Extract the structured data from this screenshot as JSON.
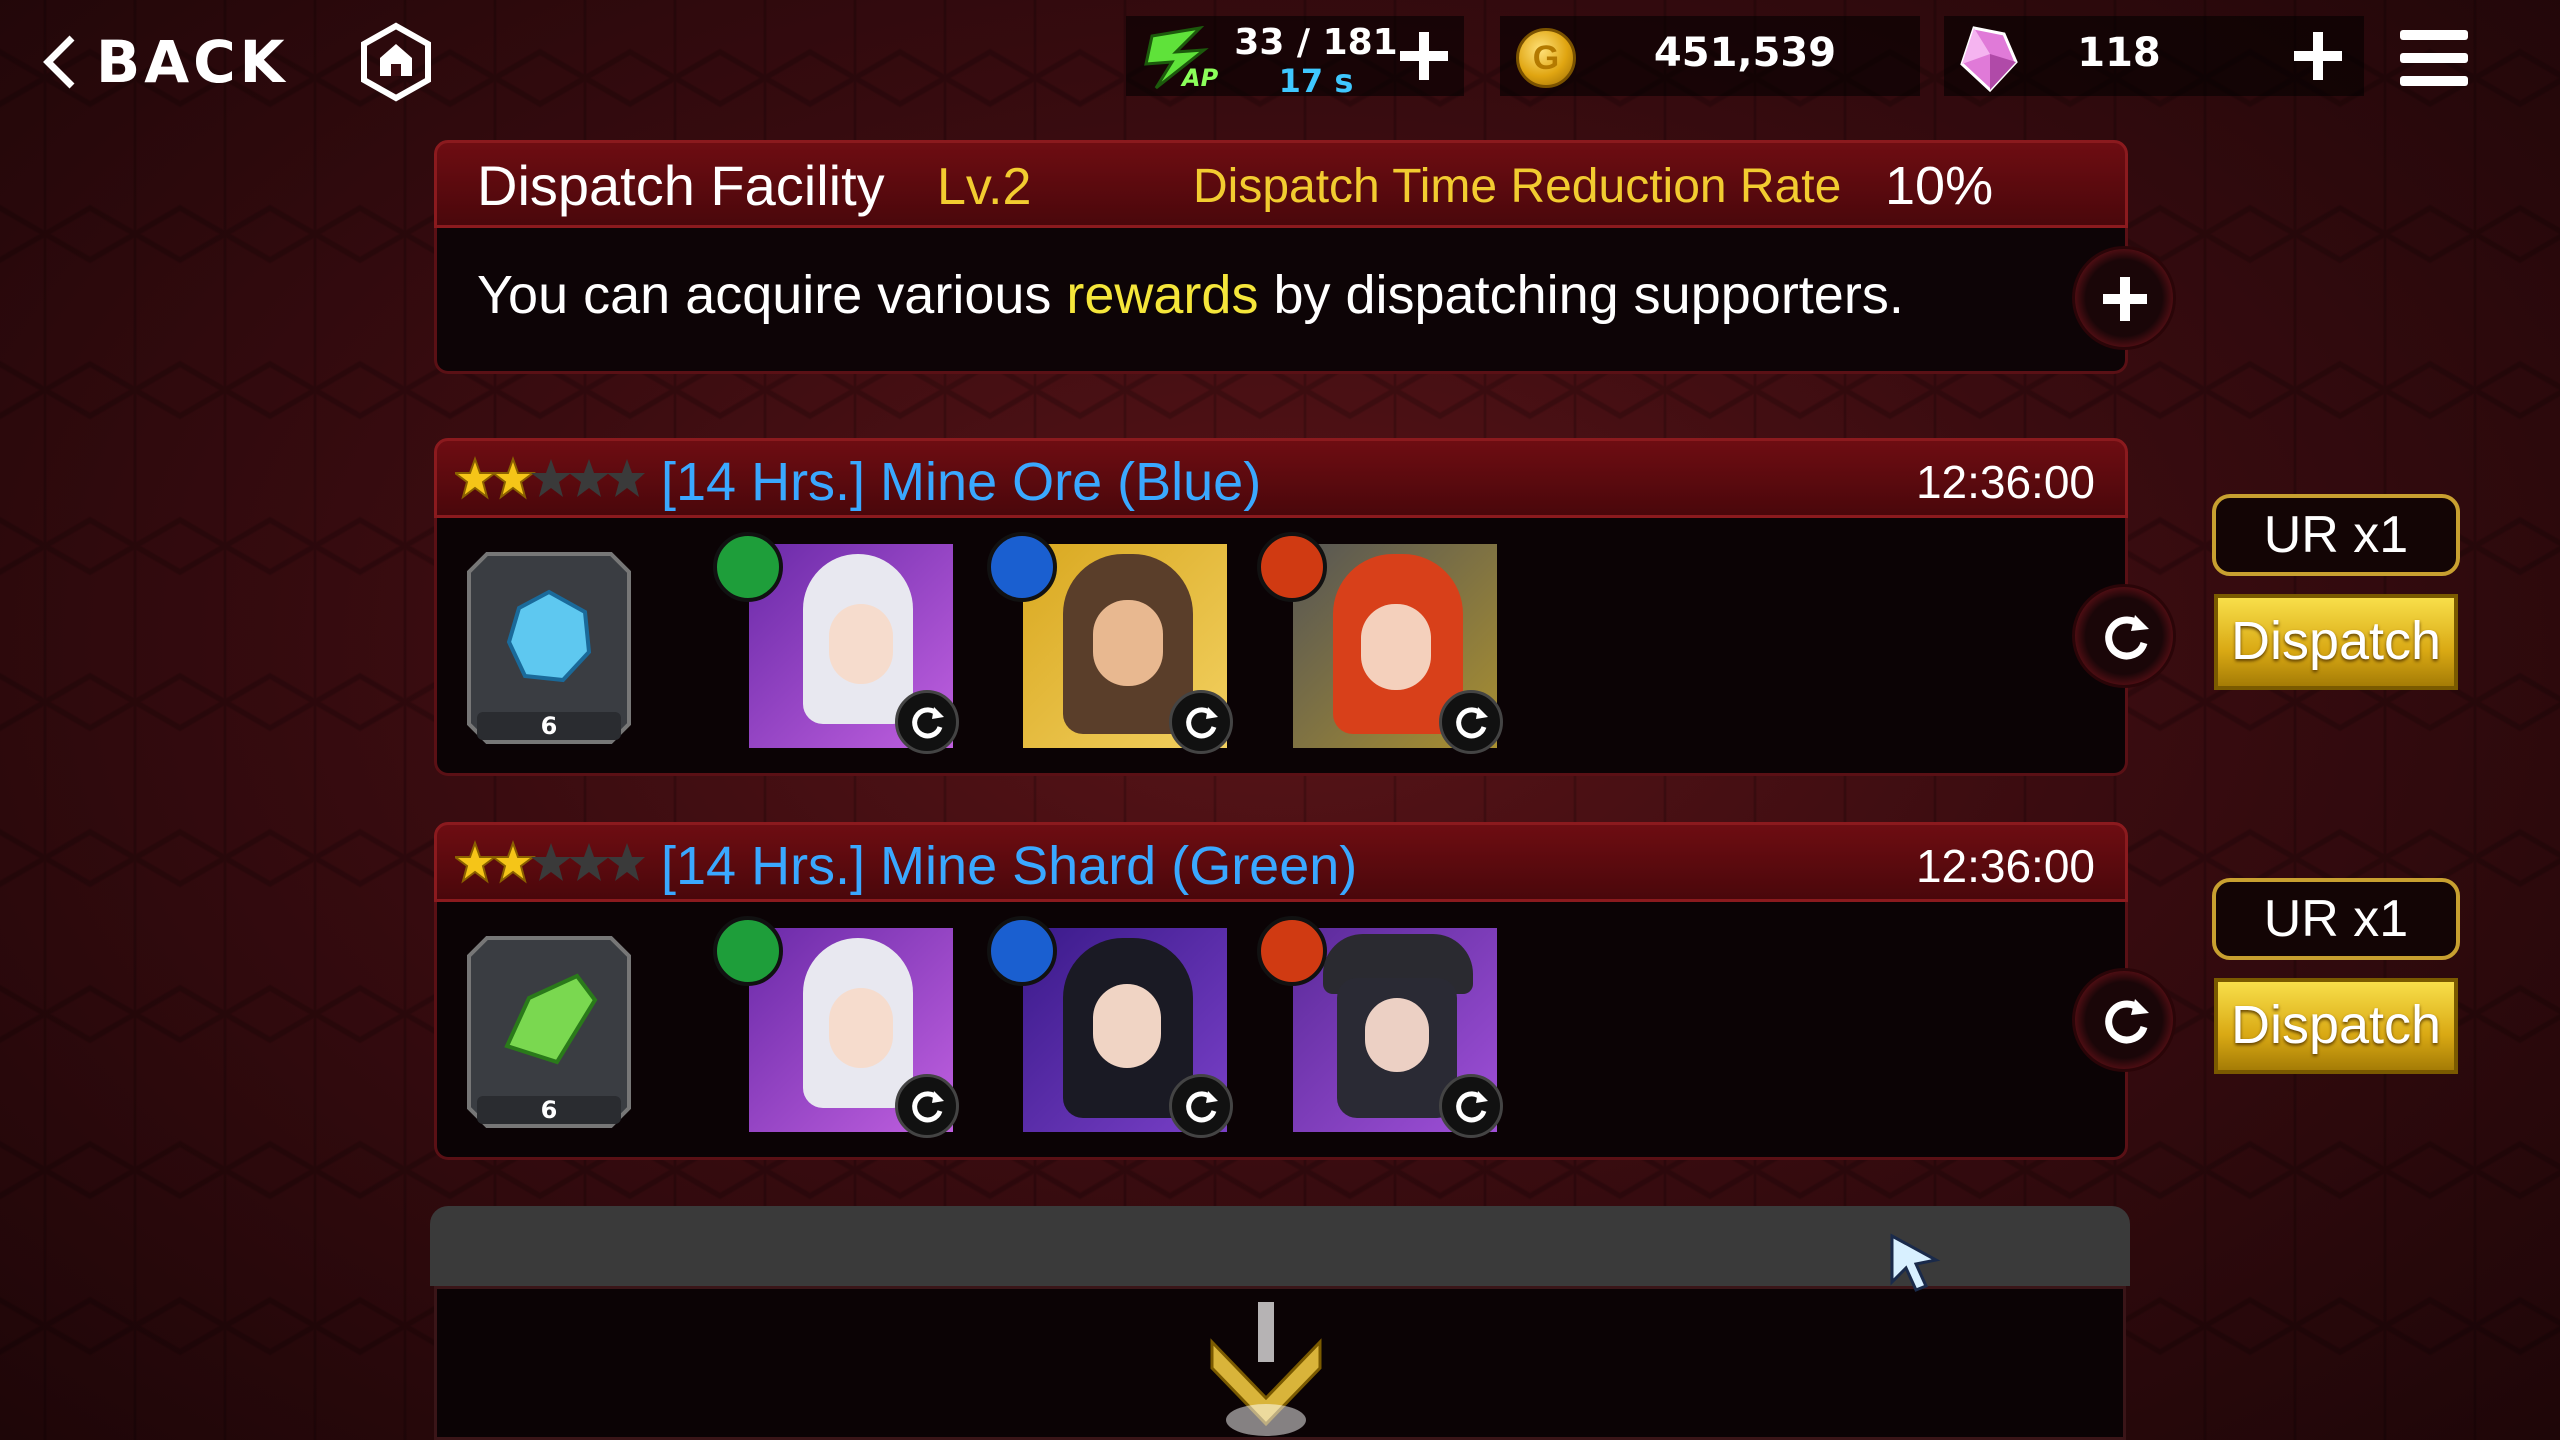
{
  "topbar": {
    "back_label": "BACK",
    "ap_current_max": "33 / 181",
    "ap_timer": "17 s",
    "ap_icon_label": "AP",
    "gold": "451,539",
    "gems": "118"
  },
  "facility": {
    "title": "Dispatch Facility",
    "level": "Lv.2",
    "rate_label": "Dispatch Time Reduction Rate",
    "rate_value": "10%",
    "desc_pre": "You can acquire various ",
    "desc_highlight": "rewards",
    "desc_post": " by dispatching supporters."
  },
  "missions": [
    {
      "stars_filled": 2,
      "stars_total": 5,
      "title": "[14 Hrs.] Mine Ore (Blue)",
      "time": "12:36:00",
      "item": {
        "icon": "blue-ore-icon",
        "count": "6",
        "color": "#4fb8e8"
      },
      "supporters": [
        {
          "element": "wind-icon",
          "element_color": "#1e9e3a",
          "portrait": "white-haired-girl"
        },
        {
          "element": "water-icon",
          "element_color": "#1a5fd0",
          "portrait": "brown-haired-girl"
        },
        {
          "element": "fire-icon",
          "element_color": "#d03a12",
          "portrait": "red-haired-girl"
        }
      ],
      "requirement": "UR x1",
      "dispatch_label": "Dispatch"
    },
    {
      "stars_filled": 2,
      "stars_total": 5,
      "title": "[14 Hrs.] Mine Shard (Green)",
      "time": "12:36:00",
      "item": {
        "icon": "green-shard-icon",
        "count": "6",
        "color": "#6fd048"
      },
      "supporters": [
        {
          "element": "wind-icon",
          "element_color": "#1e9e3a",
          "portrait": "white-haired-girl"
        },
        {
          "element": "water-icon",
          "element_color": "#1a5fd0",
          "portrait": "black-haired-girl"
        },
        {
          "element": "fire-icon",
          "element_color": "#d03a12",
          "portrait": "cap-wearing-girl"
        }
      ],
      "requirement": "UR x1",
      "dispatch_label": "Dispatch"
    }
  ]
}
